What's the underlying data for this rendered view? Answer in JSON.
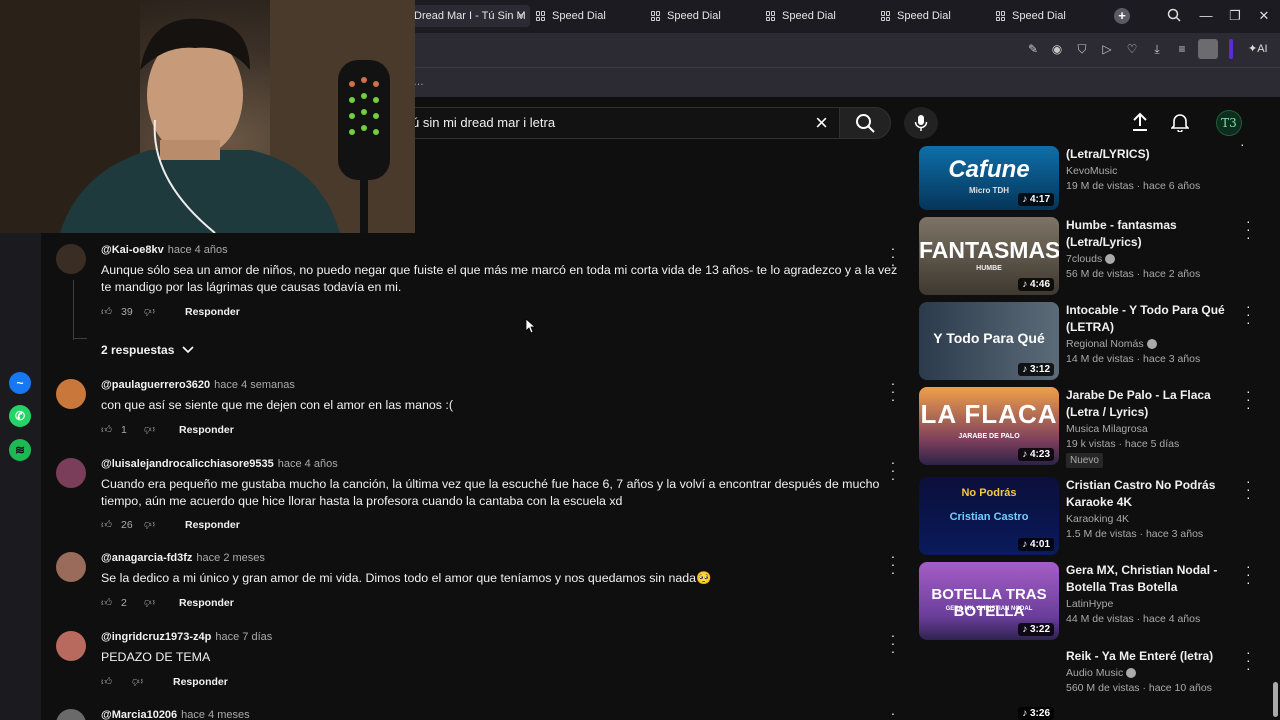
{
  "tabs": [
    {
      "label": "Dread Mar I - Tú Sin M",
      "active": true,
      "close": "×"
    },
    {
      "label": "Speed Dial"
    },
    {
      "label": "Speed Dial"
    },
    {
      "label": "Speed Dial"
    },
    {
      "label": "Speed Dial"
    },
    {
      "label": "Speed Dial"
    }
  ],
  "toolbar": {
    "ai_label": "AI"
  },
  "search": {
    "query": "ú sin mi dread mar i letra",
    "clear": "×"
  },
  "avatar_initials": "T3",
  "comments": [
    {
      "user": "@Kai-oe8kv",
      "time": "hace 4 años",
      "text": "Aunque sólo sea un amor de niños, no puedo negar que fuiste el que más me marcó en toda mi corta vida de 13 años- te lo agradezco y a la vez te mandigo por las lágrimas que causas todavía en mi.",
      "likes": "39",
      "reply": "Responder",
      "replies_label": "2 respuestas"
    },
    {
      "user": "@paulaguerrero3620",
      "time": "hace 4 semanas",
      "text": "con que así se siente que me dejen con el amor en las manos :(",
      "likes": "1",
      "reply": "Responder"
    },
    {
      "user": "@luisalejandrocalicchiasore9535",
      "time": "hace 4 años",
      "text": "Cuando era pequeño me gustaba mucho la canción, la última vez que la escuché fue hace 6, 7 años y la volví a encontrar después de mucho tiempo, aún me acuerdo que hice llorar hasta la profesora cuando la cantaba con la escuela xd",
      "likes": "26",
      "reply": "Responder"
    },
    {
      "user": "@anagarcia-fd3fz",
      "time": "hace 2 meses",
      "text": "Se la dedico a mi único y gran amor de mi vida. Dimos todo el amor que teníamos y nos quedamos sin nada🥺",
      "likes": "2",
      "reply": "Responder"
    },
    {
      "user": "@ingridcruz1973-z4p",
      "time": "hace 7 días",
      "text": "PEDAZO DE TEMA",
      "likes": "",
      "reply": "Responder"
    },
    {
      "user": "@Marcia10206",
      "time": "hace 4 meses",
      "text": "",
      "likes": "",
      "reply": ""
    }
  ],
  "recs": [
    {
      "thumb_text": "Cafune",
      "thumb_sub": "Micro TDH",
      "duration": "4:17",
      "title": "(Letra/LYRICS)",
      "channel": "KevoMusic",
      "meta": "19 M de vistas · hace 6 años",
      "badge": ""
    },
    {
      "thumb_text": "FANTASMAS",
      "thumb_sub": "HUMBE",
      "duration": "4:46",
      "title": "Humbe - fantasmas (Letra/Lyrics)",
      "channel": "7clouds",
      "meta": "56 M de vistas · hace 2 años",
      "badge": ""
    },
    {
      "thumb_text": "Y Todo Para Qué",
      "thumb_sub": "",
      "duration": "3:12",
      "title": "Intocable - Y Todo Para Qué (LETRA)",
      "channel": "Regional Nomás",
      "meta": "14 M de vistas · hace 3 años",
      "badge": ""
    },
    {
      "thumb_text": "LA FLACA",
      "thumb_sub": "JARABE DE PALO",
      "duration": "4:23",
      "title": "Jarabe De Palo - La Flaca (Letra / Lyrics)",
      "channel": "Musica Milagrosa",
      "meta": "19 k vistas · hace 5 días",
      "badge": "Nuevo"
    },
    {
      "thumb_text": "No Podrás",
      "thumb_sub": "Cristian Castro",
      "duration": "4:01",
      "title": "Cristian Castro  No Podrás Karaoke 4K",
      "channel": "Karaoking 4K",
      "meta": "1.5 M de vistas · hace 3 años",
      "badge": ""
    },
    {
      "thumb_text": "BOTELLA TRAS BOTELLA",
      "thumb_sub": "GERA MX, CHRISTIAN NODAL",
      "duration": "3:22",
      "title": "Gera MX, Christian Nodal - Botella Tras Botella",
      "channel": "LatinHype",
      "meta": "44 M de vistas · hace 4 años",
      "badge": ""
    },
    {
      "thumb_text": "",
      "thumb_sub": "",
      "duration": "3:26",
      "title": "Reik - Ya Me Enteré (letra)",
      "channel": "Audio Music",
      "meta": "560 M de vistas · hace 10 años",
      "badge": ""
    }
  ],
  "colors": {
    "bg": "#0f0f0f",
    "tabbar": "#1c1b22",
    "messenger": "#1877f2",
    "whatsapp": "#25d366",
    "spotify": "#1db954"
  }
}
